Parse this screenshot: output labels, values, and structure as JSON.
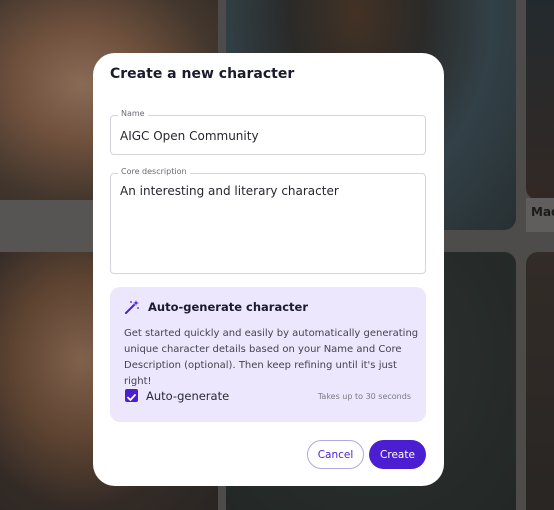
{
  "background": {
    "side_label": "Mad"
  },
  "dialog": {
    "title": "Create a new character",
    "name_field": {
      "label": "Name",
      "value": "AIGC Open Community"
    },
    "core_field": {
      "label": "Core description",
      "value": "An interesting and literary character"
    },
    "auto_generate": {
      "icon": "magic-wand-icon",
      "title": "Auto-generate character",
      "description": "Get started quickly and easily by automatically generating unique character details based on your Name and Core Description (optional). Then keep refining until it's just right!",
      "checkbox_label": "Auto-generate",
      "checked": true,
      "hint": "Takes up to 30 seconds"
    },
    "buttons": {
      "cancel": "Cancel",
      "create": "Create"
    }
  },
  "colors": {
    "accent": "#4b1fd1",
    "auto_box_bg": "#ece7fc"
  }
}
